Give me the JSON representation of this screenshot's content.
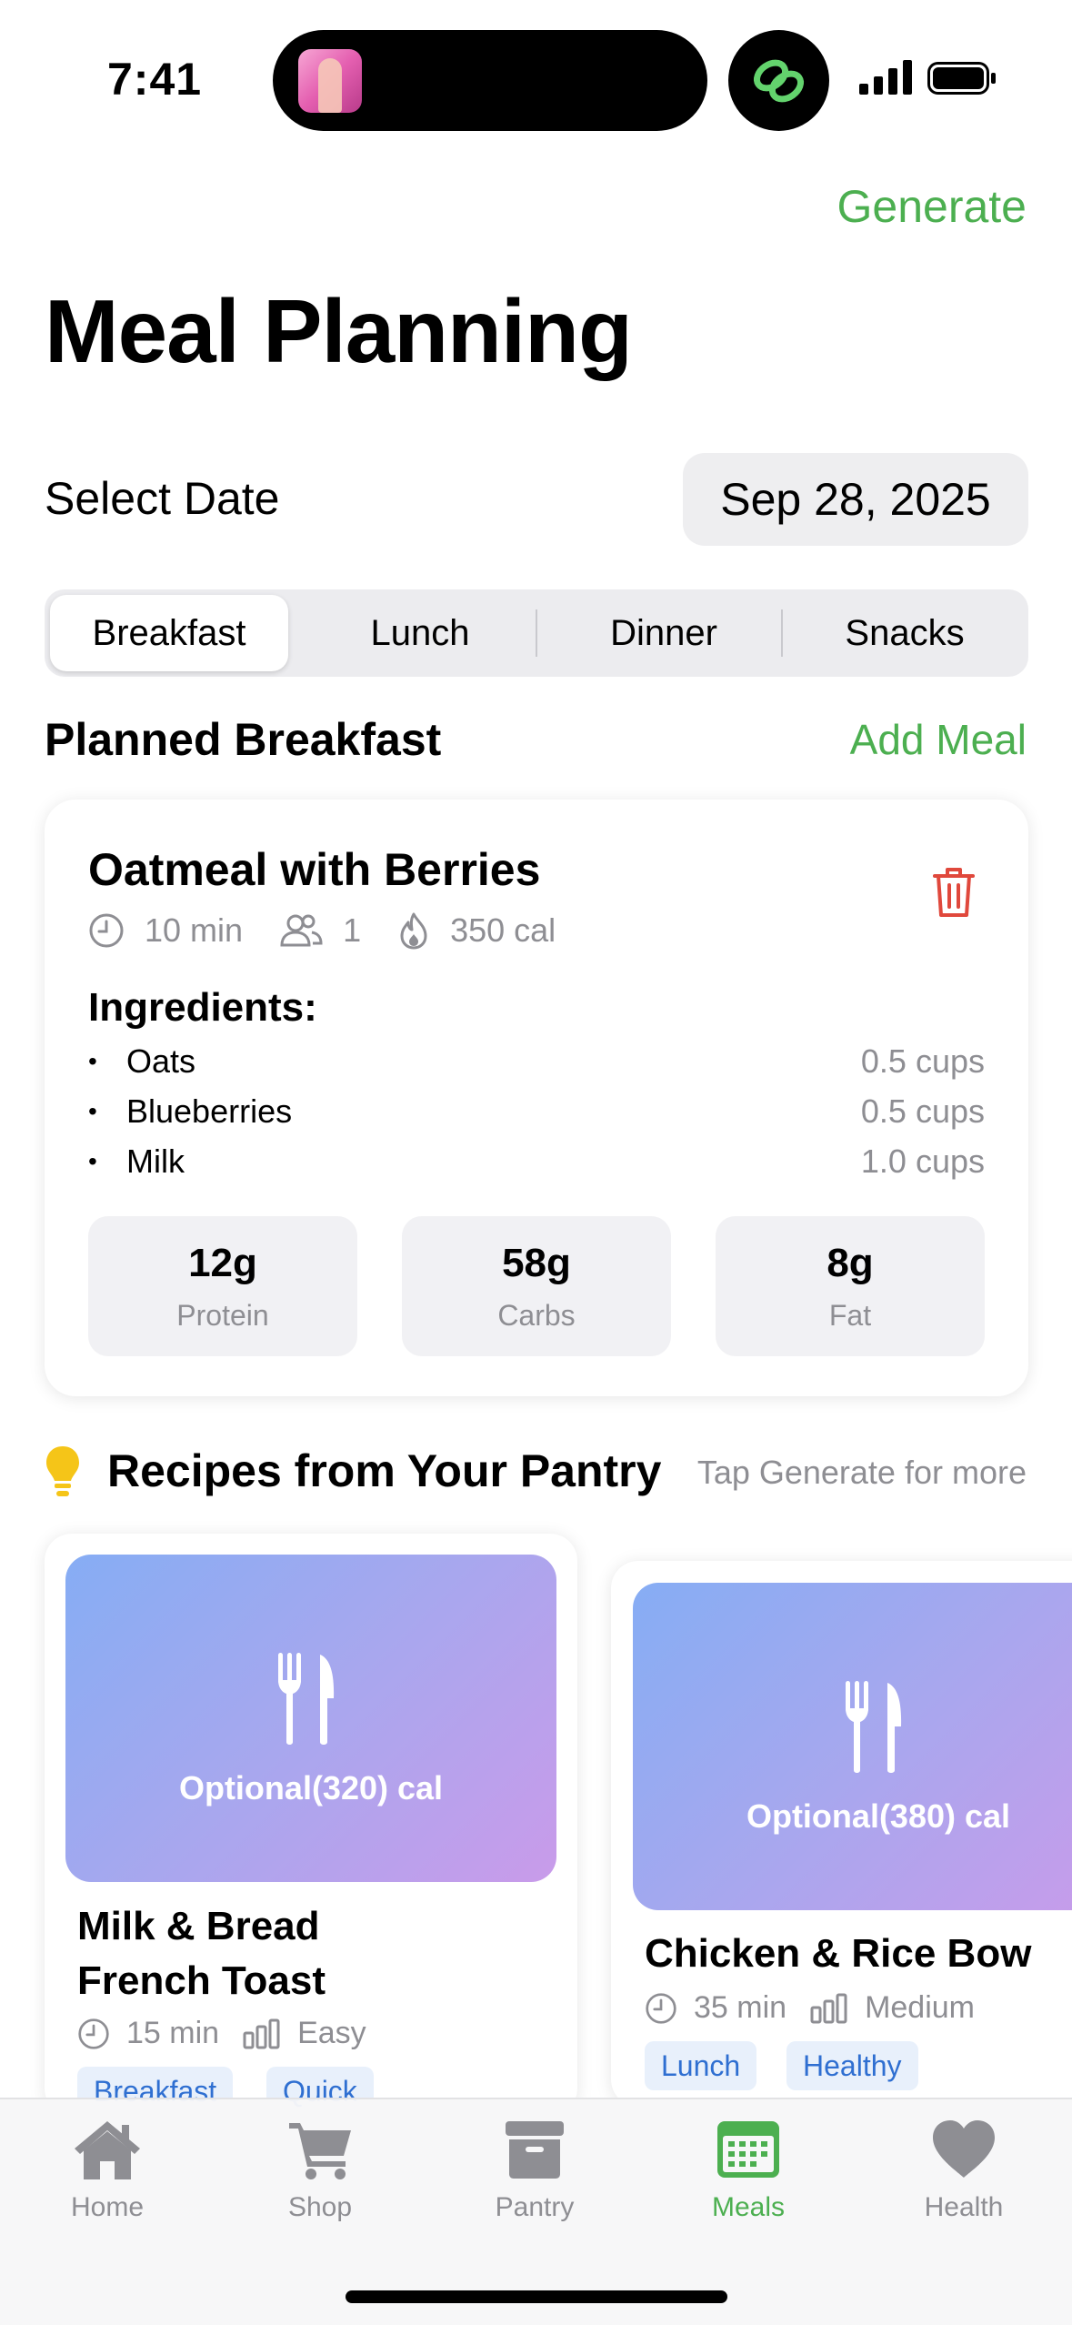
{
  "status_bar": {
    "time": "7:41"
  },
  "header": {
    "generate_label": "Generate",
    "title": "Meal Planning"
  },
  "date_row": {
    "label": "Select Date",
    "value": "Sep 28, 2025"
  },
  "segments": {
    "items": [
      "Breakfast",
      "Lunch",
      "Dinner",
      "Snacks"
    ],
    "selected": "Breakfast"
  },
  "planned": {
    "title": "Planned Breakfast",
    "add_label": "Add Meal",
    "meal": {
      "name": "Oatmeal with Berries",
      "time": "10 min",
      "servings": "1",
      "calories": "350 cal",
      "ingredients_label": "Ingredients:",
      "ingredients": [
        {
          "bullet": "•",
          "name": "Oats",
          "amount": "0.5 cups"
        },
        {
          "bullet": "•",
          "name": "Blueberries",
          "amount": "0.5 cups"
        },
        {
          "bullet": "•",
          "name": "Milk",
          "amount": "1.0 cups"
        }
      ],
      "macros": [
        {
          "value": "12g",
          "label": "Protein"
        },
        {
          "value": "58g",
          "label": "Carbs"
        },
        {
          "value": "8g",
          "label": "Fat"
        }
      ]
    }
  },
  "pantry": {
    "title": "Recipes from Your Pantry",
    "hint": "Tap Generate for more",
    "recipes": [
      {
        "calories": "Optional(320) cal",
        "name_line1": "Milk & Bread",
        "name_line2": "French Toast",
        "time": "15 min",
        "difficulty": "Easy",
        "tags": [
          "Breakfast",
          "Quick"
        ]
      },
      {
        "calories": "Optional(380) cal",
        "name_line1": "Chicken & Rice Bow",
        "time": "35 min",
        "difficulty": "Medium",
        "tags": [
          "Lunch",
          "Healthy"
        ]
      }
    ]
  },
  "tab_bar": {
    "items": [
      {
        "label": "Home",
        "icon": "house-icon"
      },
      {
        "label": "Shop",
        "icon": "cart-icon"
      },
      {
        "label": "Pantry",
        "icon": "archivebox-icon"
      },
      {
        "label": "Meals",
        "icon": "calendar-icon"
      },
      {
        "label": "Health",
        "icon": "heart-icon"
      }
    ],
    "selected": "Meals"
  },
  "colors": {
    "accent": "#4caf50",
    "danger": "#e0483c",
    "tag_bg": "#e8f0fb",
    "tag_text": "#2f6fd1"
  }
}
